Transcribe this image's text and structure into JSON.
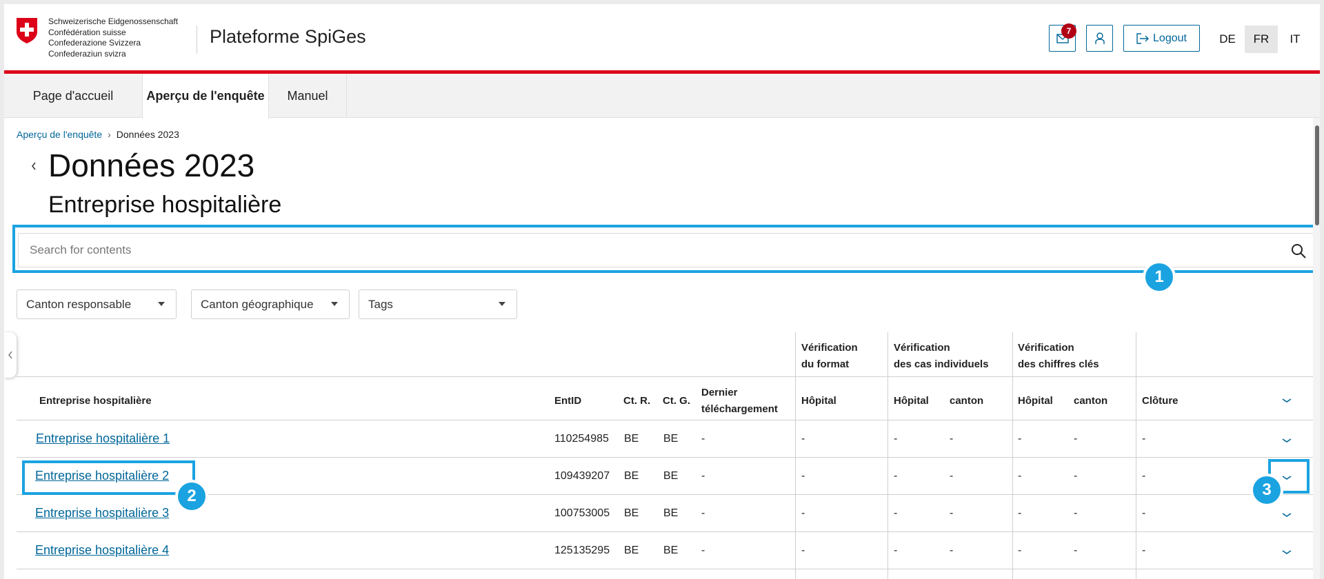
{
  "header": {
    "confederation": [
      "Schweizerische Eidgenossenschaft",
      "Confédération suisse",
      "Confederazione Svizzera",
      "Confederaziun svizra"
    ],
    "app_title": "Plateforme SpiGes",
    "notification_count": "7",
    "logout_label": "Logout",
    "languages": [
      "DE",
      "FR",
      "IT"
    ],
    "active_language": "FR",
    "brand_red": "#dc0018"
  },
  "nav": {
    "tabs": [
      "Page d'accueil",
      "Aperçu de l'enquête",
      "Manuel"
    ],
    "active_tab": "Aperçu de l'enquête"
  },
  "breadcrumb": [
    "Aperçu de l'enquête",
    "Données 2023"
  ],
  "page": {
    "title": "Données 2023",
    "subtitle": "Entreprise hospitalière"
  },
  "search": {
    "placeholder": "Search for contents"
  },
  "filters": [
    "Canton responsable",
    "Canton géographique",
    "Tags"
  ],
  "callouts": [
    "1",
    "2",
    "3"
  ],
  "table": {
    "group_headers": {
      "format": [
        "Vérification",
        "du format"
      ],
      "cases": [
        "Vérification",
        "des cas individuels"
      ],
      "figures": [
        "Vérification",
        "des chiffres clés"
      ]
    },
    "columns": {
      "enterprise": "Entreprise hospitalière",
      "entid": "EntID",
      "ctr": "Ct. R.",
      "ctg": "Ct. G.",
      "download": [
        "Dernier",
        "téléchargement"
      ],
      "format_hospital": "Hôpital",
      "cases_hospital": "Hôpital",
      "cases_canton": "canton",
      "figures_hospital": "Hôpital",
      "figures_canton": "canton",
      "closure": "Clôture"
    },
    "rows": [
      {
        "name": "Entreprise hospitalière 1",
        "entid": "110254985",
        "ctr": "BE",
        "ctg": "BE",
        "download": "-",
        "fmt_h": "-",
        "cas_h": "-",
        "cas_c": "-",
        "fig_h": "-",
        "fig_c": "-",
        "closure": "-"
      },
      {
        "name": "Entreprise hospitalière 2",
        "entid": "109439207",
        "ctr": "BE",
        "ctg": "BE",
        "download": "-",
        "fmt_h": "-",
        "cas_h": "-",
        "cas_c": "-",
        "fig_h": "-",
        "fig_c": "-",
        "closure": "-"
      },
      {
        "name": "Entreprise hospitalière 3",
        "entid": "100753005",
        "ctr": "BE",
        "ctg": "BE",
        "download": "-",
        "fmt_h": "-",
        "cas_h": "-",
        "cas_c": "-",
        "fig_h": "-",
        "fig_c": "-",
        "closure": "-"
      },
      {
        "name": "Entreprise hospitalière 4",
        "entid": "125135295",
        "ctr": "BE",
        "ctg": "BE",
        "download": "-",
        "fmt_h": "-",
        "cas_h": "-",
        "cas_c": "-",
        "fig_h": "-",
        "fig_c": "-",
        "closure": "-"
      }
    ]
  },
  "colors": {
    "link": "#006699",
    "annotation": "#1aa3e0"
  }
}
